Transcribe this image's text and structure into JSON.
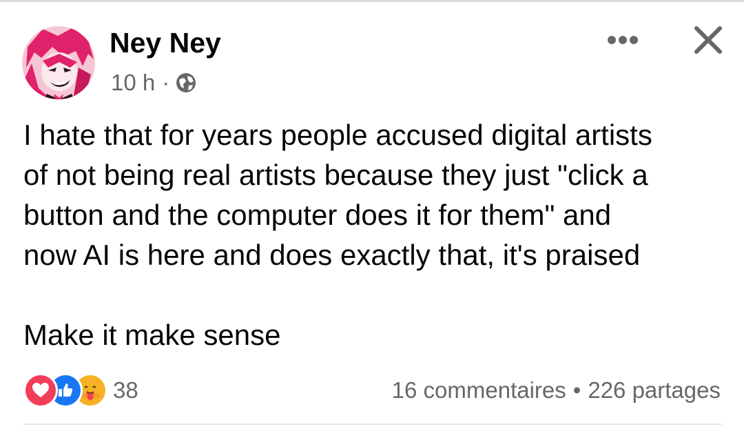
{
  "post": {
    "author": {
      "name": "Ney Ney",
      "avatar": "anime-character-avatar"
    },
    "time": "10 h",
    "meta_separator": "·",
    "audience_icon": "globe-icon",
    "header_icons": {
      "more": "more-horizontal-icon",
      "close": "close-icon"
    },
    "text": {
      "line1": "I hate that for years people accused digital artists",
      "line2": "of not being real artists because they just \"click a",
      "line3": "button and the computer does it for them\" and",
      "line4": "now AI is here and does exactly that, it's praised",
      "line5": "Make it make sense"
    },
    "reactions": {
      "types": [
        "love",
        "like",
        "care"
      ],
      "count": "38"
    },
    "stats": {
      "comments": "16 commentaires",
      "separator": "•",
      "shares": "226 partages"
    }
  },
  "colors": {
    "text_primary": "#050505",
    "text_secondary": "#65676b",
    "like_blue": "#1877f2",
    "love_red": "#f33e58",
    "care_yellow": "#f7b125"
  }
}
